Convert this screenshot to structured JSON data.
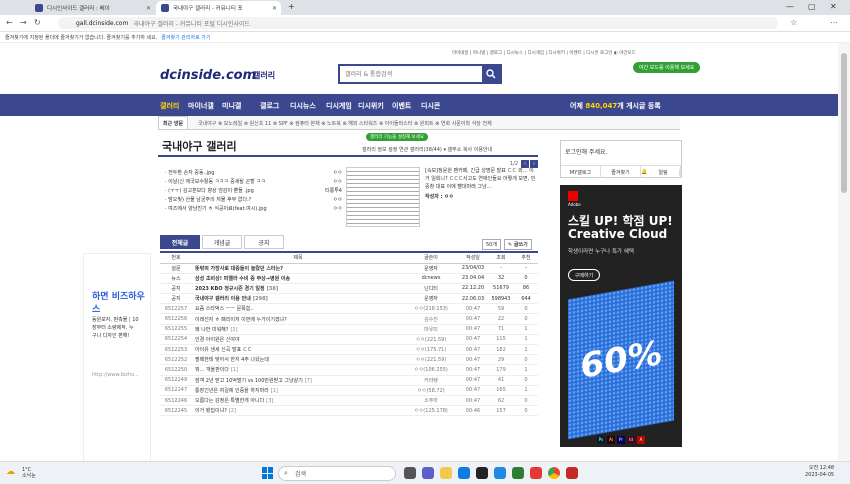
{
  "browser": {
    "tabs": [
      {
        "title": "디시인사이드 갤러리 : 베이",
        "color": "#3b4890"
      },
      {
        "title": "국내야구 갤러리 - 커뮤니티 포",
        "color": "#3b4890"
      }
    ],
    "url": "gall.dcinside.com",
    "url_rest": "국내야구 갤러리 - 커뮤니티 포털 디시인사이드",
    "bookmark_msg": "즐겨찾기에 지정된 폴더에 즐겨찾기가 없습니다. 즐겨찾기를 추가하 세요.",
    "bookmark_link": "즐겨찾기 관리자로 가기"
  },
  "site": {
    "top_links": "마이네일 | 마니빌 | 갤로그 | 디시뉴스 | 디시게임 | 디시위키 | 이벤트 | 디시콘 로그인 ◐ 야간모드",
    "logo": "dcinside.com",
    "logo_sub": "갤러리",
    "search_placeholder": "갤러리 & 통합검색",
    "darkmode_btn": "야간 모드를 이용해 보세요",
    "nav": [
      "갤러리",
      "마이너갤",
      "미니갤",
      "갤로그",
      "디시뉴스",
      "디시게임",
      "디시위키",
      "이벤트",
      "디시콘"
    ],
    "nav_count_pre": "어제 ",
    "nav_count": "840,047",
    "nav_count_post": "개 게시글 등록",
    "subnav_first": "최근 방문",
    "subnav_items": "국내야구 ⊗   모노레일 ⊗   원신초 11 ⊗   SPF ⊗   컴퓨터 본체 ⊗   노트북 ⊗   해외 스타워즈 ⊗   아이돌마스터 ⊗   원피트 ⊗   연화   사문어학   식당   전체"
  },
  "gallery": {
    "title": "국내야구 갤러리",
    "badge": "갤러리 기능을 설정해 보세요",
    "tools": "갤러리 정보  설정  연관 갤러리(38/44)  ▾  갤주소 복사  이용안내",
    "concept": [
      "· 전두환 손자 중동..jpg",
      "· 이날(신 애국보수활동 ㅋㅋㅋ 중세될 곤할 ㅋㅋ",
      "· (ㅜㅜ) 김고훈보다 향상 엄감이 뿐들 .jpg",
      "· 밤오빛) 산물 남궁주의 저물 후부 없다.?",
      "· 여즈에서 양냥친기 ㅎ 식공이료(feat.여시).jpg"
    ],
    "concept_meta": [
      "ㅇㅇ",
      "ㅇㅇ",
      "티롱투4",
      "ㅇㅇ",
      "ㅇㅇ"
    ],
    "news": "[속보]정윤원 팬카페, 긴급 성명문 발표 ㄷㄷ 와... 이거 일회니? ㄷㄷㄷ사고도 연애인들요 어떻게 보면, 민중창 대표 이에 빨대마래 그냥...",
    "news_author": "작성자 : ㅇㅇ",
    "page": "1/2"
  },
  "tabs": [
    "전체글",
    "개념글",
    "공지"
  ],
  "list_ctrl": {
    "count": "50개",
    "write": "글쓰기"
  },
  "table": {
    "headers": [
      "번호",
      "제목",
      "글쓴이",
      "작성일",
      "조회",
      "추천"
    ],
    "rows": [
      {
        "no": "설문",
        "subj": "뜻밖의 가장사로 대중들이 놀랐던 스타는?",
        "cmt": "",
        "author": "운영자",
        "date": "23/04/03",
        "views": "-",
        "rec": "-",
        "notice": true
      },
      {
        "no": "뉴스",
        "subj": "삼성 초비상! 피렐라 수비 중 부상→병원 이송",
        "cmt": "",
        "author": "dcnews",
        "date": "23.04.04",
        "views": "32",
        "rec": "0",
        "notice": true
      },
      {
        "no": "공지",
        "subj": "2023 KBO 정규시즌 경기 일정",
        "cmt": "[38]",
        "author": "닌디티",
        "date": "22.12.20",
        "views": "51679",
        "rec": "86",
        "notice": true
      },
      {
        "no": "공지",
        "subj": "국내야구 갤러리 이용 안내",
        "cmt": "[298]",
        "author": "운영자",
        "date": "22.06.03",
        "views": "598943",
        "rec": "644",
        "notice": true
      },
      {
        "no": "6512257",
        "subj": "요즘 스타벅스 ㅡㅡ 문폭힘..",
        "cmt": "",
        "author": "ㅇㅇ(218.153)",
        "date": "00:47",
        "views": "59",
        "rec": "0"
      },
      {
        "no": "6512256",
        "subj": "이래선지 ㅎ 패리이저 이번에 누가이기겠냐?",
        "cmt": "",
        "author": "김수진",
        "date": "00:47",
        "views": "22",
        "rec": "0"
      },
      {
        "no": "6512255",
        "subj": "왜 나만 미워해?",
        "cmt": "[2]",
        "author": "마유미",
        "date": "00:47",
        "views": "71",
        "rec": "1"
      },
      {
        "no": "6512254",
        "subj": "인경 아이원은 신야야",
        "cmt": "",
        "author": "ㅇㅇ(221.59)",
        "date": "00:47",
        "views": "115",
        "rec": "1"
      },
      {
        "no": "6512253",
        "subj": "아이유 생세 신곡 발표 ㄷㄷ",
        "cmt": "",
        "author": "ㅇㅇ(175.71)",
        "date": "00:47",
        "views": "182",
        "rec": "1"
      },
      {
        "no": "6512252",
        "subj": "펄떼한테 맞아서 한지 4주 나왔는데",
        "cmt": "",
        "author": "ㅇㅇ(221.59)",
        "date": "00:47",
        "views": "29",
        "rec": "0"
      },
      {
        "no": "6512250",
        "subj": "뭐... 개울판이다",
        "cmt": "[1]",
        "author": "ㅇㅇ(106.255)",
        "date": "00:47",
        "views": "179",
        "rec": "1"
      },
      {
        "no": "6512249",
        "subj": "잠객 2년 받고 10억벌기 vs 100만원받고 그냥살기",
        "cmt": "[7]",
        "author": "커라탱",
        "date": "00:47",
        "views": "41",
        "rec": "0"
      },
      {
        "no": "6512247",
        "subj": "통장긴년은 여길에 인증을 하지마라",
        "cmt": "[1]",
        "author": "ㅇㅇ(58.72)",
        "date": "00:47",
        "views": "165",
        "rec": "1"
      },
      {
        "no": "6512246",
        "subj": "오름다는 감정은 특별한게 아니다",
        "cmt": "[3]",
        "author": "소주마",
        "date": "00:47",
        "views": "62",
        "rec": "0"
      },
      {
        "no": "6512245",
        "subj": "이거 봤집이냐?",
        "cmt": "[2]",
        "author": "ㅇㅇ(125.178)",
        "date": "00:46",
        "views": "157",
        "rec": "0"
      }
    ]
  },
  "login": {
    "msg": "로그인해 주세요.",
    "buttons": [
      "MY갤로그",
      "즐겨찾기",
      "알림"
    ]
  },
  "ad": {
    "brand": "Adobe",
    "line1": "스킬 UP! 학점 UP!",
    "line2": "Creative Cloud",
    "line3": "학생이라면 누구나 특가 혜택",
    "btn": "구매하기",
    "pct": "60%",
    "apps": [
      "Ps",
      "Ai",
      "Pr",
      "Id",
      "A"
    ]
  },
  "left_ad": {
    "head": "하면 비즈하우스",
    "body": [
      "동원모자, 판촉물 | 10",
      "장부터 소량제작, 누",
      "구나 디자인 편해!"
    ],
    "url": "http://www.bizho..."
  },
  "taskbar": {
    "weather_temp": "1°C",
    "weather_desc": "소낙눈",
    "search": "검색",
    "time": "오전 12:48",
    "date": "2023-04-05"
  }
}
